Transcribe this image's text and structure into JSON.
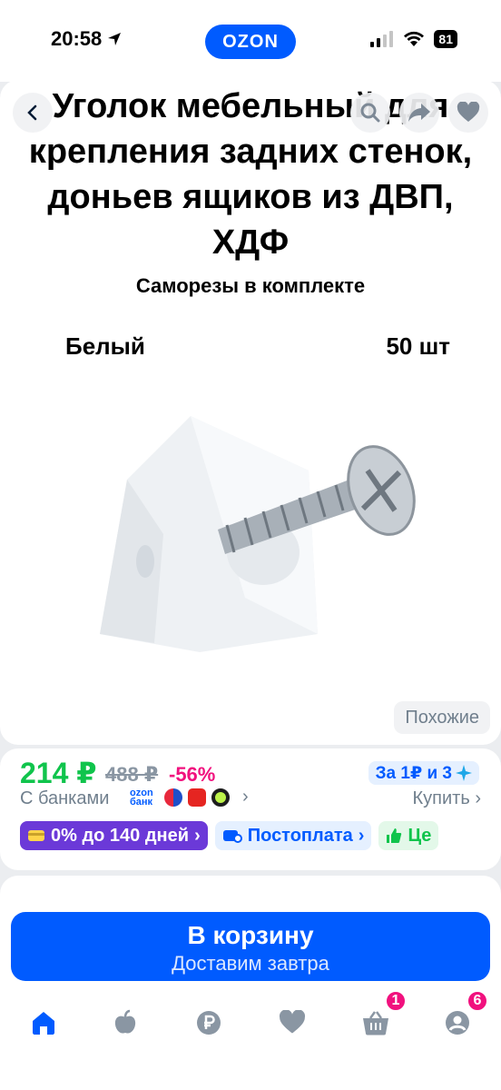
{
  "status_bar": {
    "time": "20:58",
    "battery": "81",
    "logo": "OZON"
  },
  "product": {
    "title": "Уголок мебельный для крепления задних стенок, доньев ящиков из ДВП, ХДФ",
    "subtitle": "Саморезы в комплекте",
    "color": "Белый",
    "quantity": "50 шт",
    "similar_label": "Похожие"
  },
  "price": {
    "current": "214 ₽",
    "old": "488 ₽",
    "discount": "-56%",
    "promo": "За 1₽ и 3",
    "banks_label": "С банками",
    "bank_ozon": "ozon банк",
    "buy_label": "Купить",
    "chips": {
      "installment": "0% до 140 дней",
      "postpay": "Постоплата",
      "more": "Це"
    }
  },
  "cart": {
    "label": "В корзину",
    "sub": "Доставим завтра"
  },
  "tabbar": {
    "cart_badge": "1",
    "profile_badge": "6"
  },
  "colors": {
    "brand": "#005bff",
    "price_green": "#10c44c",
    "discount_pink": "#f1117e",
    "installment_purple": "#6b39d8"
  }
}
